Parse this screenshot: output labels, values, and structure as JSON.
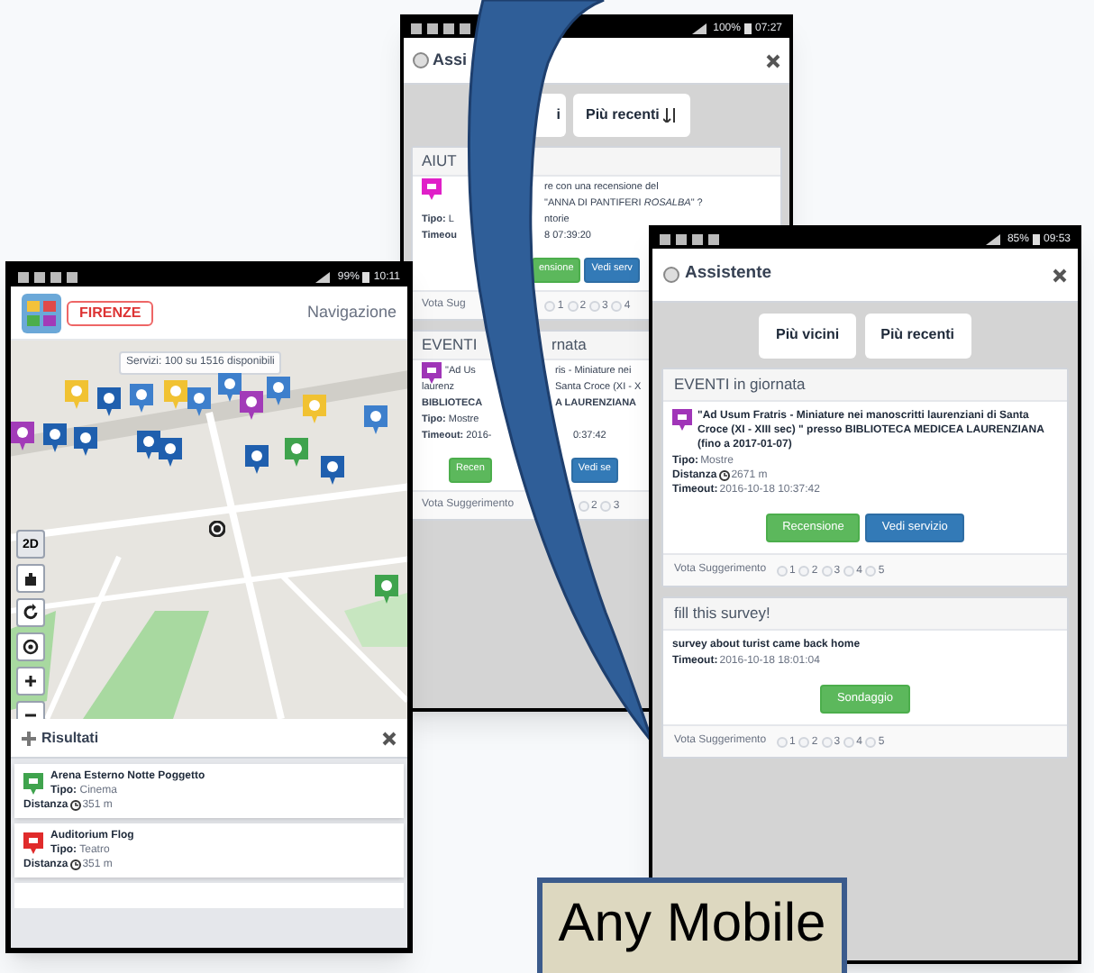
{
  "left_phone": {
    "status_bar": {
      "battery": "99%",
      "time": "10:11"
    },
    "header": {
      "city": "FIRENZE",
      "title": "Navigazione"
    },
    "map": {
      "label": "Servizi: 100 su 1516 disponibili",
      "mode_button": "2D"
    },
    "results": {
      "title": "Risultati",
      "items": [
        {
          "name": "Arena Esterno Notte Poggetto",
          "type_label": "Tipo:",
          "type": "Cinema",
          "distance_label": "Distanza",
          "distance": "351 m",
          "color": "#3fa34d"
        },
        {
          "name": "Auditorium Flog",
          "type_label": "Tipo:",
          "type": "Teatro",
          "distance_label": "Distanza",
          "distance": "351 m",
          "color": "#e02b2b"
        }
      ]
    }
  },
  "middle_phone": {
    "status_bar": {
      "battery": "100%",
      "time": "07:27"
    },
    "title": "Assi",
    "tabs": [
      {
        "label": "i",
        "selected": false
      },
      {
        "label": "Più recenti",
        "selected": false
      }
    ],
    "cards": [
      {
        "title": "AIUT",
        "color": "#e020c8",
        "lines": [
          {
            "right": "re con una recensione del"
          },
          {
            "right": "\"ANNA DI PANTIFERI *ROSALBA*\" ?"
          },
          {
            "left": "**Tipo:** L",
            "right": "ntorie"
          },
          {
            "left": "**Timeou**",
            "right": "8 07:39:20"
          }
        ],
        "buttons": [
          {
            "kind": "green",
            "label": "ensione"
          },
          {
            "kind": "blue",
            "label": "Vedi serv"
          }
        ],
        "vote_label": "Vota Sug",
        "votes": [
          {
            "label": "1",
            "selected": false
          },
          {
            "label": "2",
            "selected": false
          },
          {
            "label": "3",
            "selected": false
          },
          {
            "label": "4",
            "selected": false
          }
        ]
      },
      {
        "title": "EVENTI",
        "title_tail": "rnata",
        "color": "#a035b8",
        "lines": [
          {
            "left": "\"Ad Us",
            "right": "ris - Miniature nei"
          },
          {
            "left": "laurenz",
            "right": "Santa Croce (XI - X"
          },
          {
            "left": "**BIBLIOTECA**",
            "right": "**A LAURENZIANA**"
          },
          {
            "left": "**Tipo:** Mostre"
          },
          {
            "left": "**Timeout:** 2016-",
            "right": "0:37:42"
          }
        ],
        "buttons": [
          {
            "kind": "green",
            "label": "Recen"
          },
          {
            "kind": "blue",
            "label": "Vedi se"
          }
        ],
        "vote_label": "Vota Suggerimento",
        "votes": [
          {
            "label": "2",
            "selected": false
          },
          {
            "label": "3",
            "selected": false
          }
        ]
      }
    ]
  },
  "right_phone": {
    "status_bar": {
      "battery": "85%",
      "time": "09:53"
    },
    "title": "Assistente",
    "tabs": [
      {
        "label": "Più vicini",
        "selected": false
      },
      {
        "label": "Più recenti",
        "selected": false
      }
    ],
    "cards": [
      {
        "title": "EVENTI in giornata",
        "color": "#a035b8",
        "text": "\"Ad Usum Fratris - Miniature nei manoscritti laurenziani di Santa Croce (XI - XIII sec) \" presso BIBLIOTECA MEDICEA LAURENZIANA (fino a 2017-01-07)",
        "fields": [
          {
            "label": "Tipo:",
            "value": "Mostre"
          },
          {
            "label": "Distanza",
            "value": "2671 m",
            "kind": "distance"
          },
          {
            "label": "Timeout:",
            "value": "2016-10-18 10:37:42"
          }
        ],
        "buttons": [
          {
            "kind": "green",
            "label": "Recensione"
          },
          {
            "kind": "blue",
            "label": "Vedi servizio"
          }
        ],
        "vote_label": "Vota Suggerimento",
        "votes": [
          {
            "label": "1",
            "selected": false
          },
          {
            "label": "2",
            "selected": false
          },
          {
            "label": "3",
            "selected": false
          },
          {
            "label": "4",
            "selected": false
          },
          {
            "label": "5",
            "selected": false
          }
        ]
      },
      {
        "title": "fill this survey!",
        "text": "survey about turist came back home",
        "fields": [
          {
            "label": "Timeout:",
            "value": "2016-10-18 18:01:04"
          }
        ],
        "buttons": [
          {
            "kind": "green",
            "label": "Sondaggio"
          }
        ],
        "vote_label": "Vota Suggerimento",
        "votes": [
          {
            "label": "1",
            "selected": false
          },
          {
            "label": "2",
            "selected": false
          },
          {
            "label": "3",
            "selected": false
          },
          {
            "label": "4",
            "selected": false
          },
          {
            "label": "5",
            "selected": false
          }
        ]
      }
    ]
  },
  "caption": "Any Mobile"
}
